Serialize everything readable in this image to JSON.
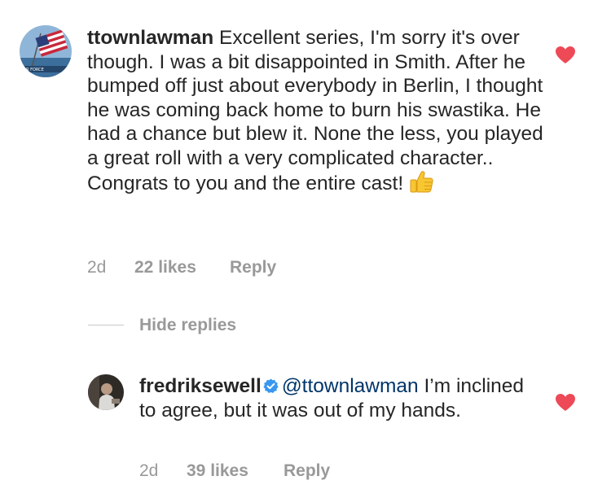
{
  "comment": {
    "username": "ttownlawman",
    "avatar_badge_text": "R FORCE",
    "text": "Excellent series, I'm sorry it's over though. I was a bit disappointed in Smith. After he bumped off just about everybody in Berlin, I thought he was coming back home to burn his swastika. He had a chance but blew it. None the less, you played a great roll with a very complicated character.. Congrats to you and the entire cast!",
    "emoji": "thumbs-up-icon",
    "age": "2d",
    "likes": "22 likes",
    "reply_label": "Reply",
    "liked": true
  },
  "replies_toggle": {
    "label": "Hide replies"
  },
  "reply": {
    "username": "fredriksewell",
    "verified": true,
    "mention": "@ttownlawman",
    "text": "I’m inclined to agree, but it was out of my hands.",
    "age": "2d",
    "likes": "39 likes",
    "reply_label": "Reply",
    "liked": true
  },
  "colors": {
    "text": "#262626",
    "muted": "#999999",
    "mention": "#003569",
    "heart": "#ed4956",
    "verified": "#3897f0"
  }
}
